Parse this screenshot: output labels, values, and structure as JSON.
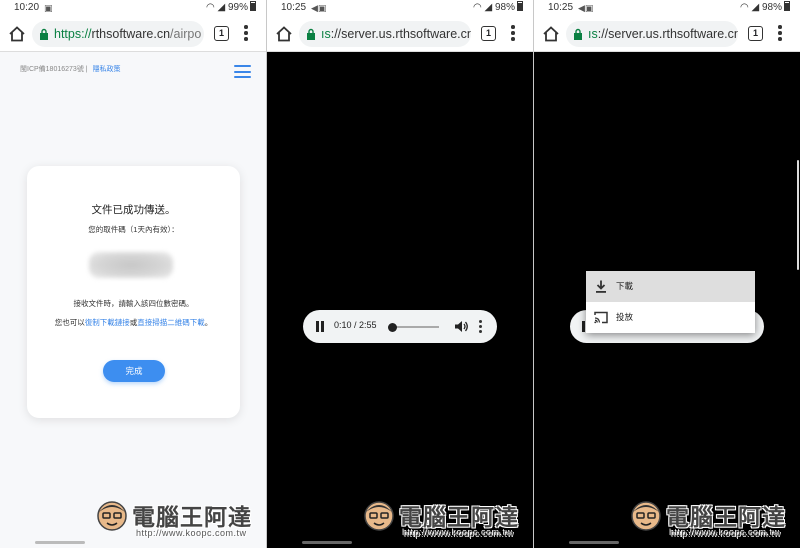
{
  "panels": [
    {
      "status": {
        "time": "10:20",
        "battery": "99%"
      },
      "url": {
        "scheme": "https://",
        "host": "rthsoftware.cn",
        "path": "/airpo"
      },
      "tab_count": "1",
      "page": {
        "icp": "閩ICP備18016273號",
        "privacy_link": "隱私政策",
        "card": {
          "title": "文件已成功傳送。",
          "subtitle": "您的取件碼（1天內有效）：",
          "note1": "接收文件時，請輸入該四位數密碼。",
          "note2_prefix": "您也可以",
          "note2_link1": "復制下載鏈接",
          "note2_mid": "或",
          "note2_link2": "直接掃描二維碼下載",
          "note2_suffix": "。",
          "done_button": "完成"
        }
      }
    },
    {
      "status": {
        "time": "10:25",
        "battery": "98%"
      },
      "url": {
        "prefix": "ıs",
        "host": "://server.us.rthsoftware.cn"
      },
      "tab_count": "1",
      "player": {
        "time_display": "0:10 / 2:55",
        "progress_fraction": 0.06
      }
    },
    {
      "status": {
        "time": "10:25",
        "battery": "98%"
      },
      "url": {
        "prefix": "ıs",
        "host": "://server.us.rthsoftware.cn"
      },
      "tab_count": "1",
      "context_menu": [
        {
          "label": "下載",
          "icon": "download-icon",
          "highlighted": true
        },
        {
          "label": "投放",
          "icon": "cast-icon",
          "highlighted": false
        }
      ]
    }
  ],
  "watermark": {
    "title": "電腦王阿達",
    "url": "http://www.koopc.com.tw"
  },
  "colors": {
    "accent": "#3d8ef0",
    "link": "#3a86e8",
    "https_green": "#0b8043",
    "highlight": "#dedede"
  }
}
